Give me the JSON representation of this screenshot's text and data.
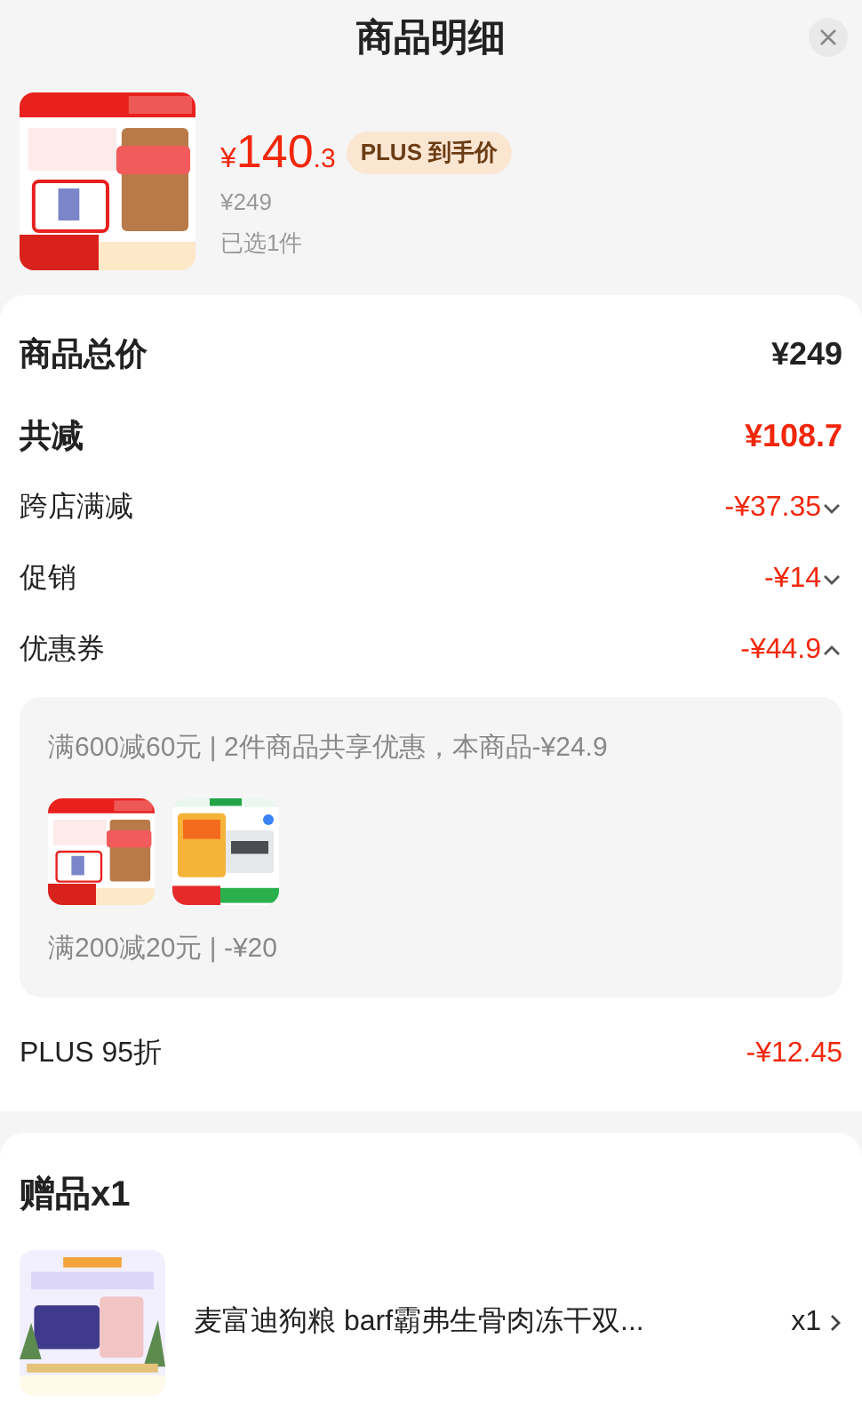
{
  "title": "商品明细",
  "product": {
    "price_symbol": "¥",
    "price_int": "140",
    "price_dec": ".3",
    "badge": "PLUS 到手价",
    "original_price": "¥249",
    "selected_count": "已选1件"
  },
  "summary": [
    {
      "kind": "total",
      "label": "商品总价",
      "value": "¥249"
    },
    {
      "kind": "discount_total",
      "label": "共减",
      "value": "¥108.7"
    },
    {
      "kind": "item",
      "label": "跨店满减",
      "value": "-¥37.35",
      "expanded": false
    },
    {
      "kind": "item",
      "label": "促销",
      "value": "-¥14",
      "expanded": false
    },
    {
      "kind": "item",
      "label": "优惠券",
      "value": "-¥44.9",
      "expanded": true
    }
  ],
  "coupon_details": [
    {
      "text": "满600减60元 | 2件商品共享优惠，本商品-¥24.9"
    },
    {
      "text": "满200减20元 | -¥20"
    }
  ],
  "plus_discount": {
    "label": "PLUS 95折",
    "value": "-¥12.45"
  },
  "gifts": {
    "title": "赠品x1",
    "items": [
      {
        "name": "麦富迪狗粮 barf霸弗生骨肉冻干双...",
        "quantity": "x1"
      }
    ]
  }
}
